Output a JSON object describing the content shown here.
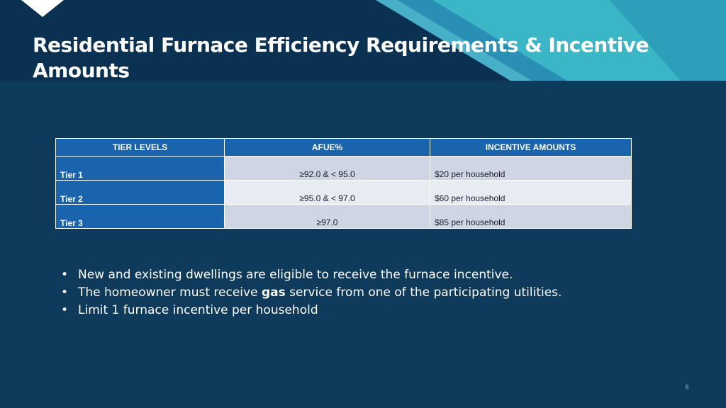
{
  "slide": {
    "title": "Residential Furnace Efficiency Requirements & Incentive Amounts",
    "page_number": "6"
  },
  "table": {
    "headers": [
      "TIER LEVELS",
      "AFUE%",
      "INCENTIVE AMOUNTS"
    ],
    "rows": [
      {
        "tier": "Tier 1",
        "afue": "≥92.0 & < 95.0",
        "incentive": "$20 per household"
      },
      {
        "tier": "Tier 2",
        "afue": "≥95.0 & < 97.0",
        "incentive": "$60 per household"
      },
      {
        "tier": "Tier 3",
        "afue": "≥97.0",
        "incentive": "$85 per household"
      }
    ]
  },
  "bullets": [
    {
      "text": "New and existing dwellings are eligible to receive the furnace incentive."
    },
    {
      "before": "The homeowner must receive ",
      "bold": "gas",
      "after": " service from one of the participating utilities."
    },
    {
      "text": "Limit 1 furnace incentive per household"
    }
  ],
  "colors": {
    "background": "#0e3a5c",
    "table_header": "#1a63ad",
    "accent_teal": "#3ab6c6"
  }
}
